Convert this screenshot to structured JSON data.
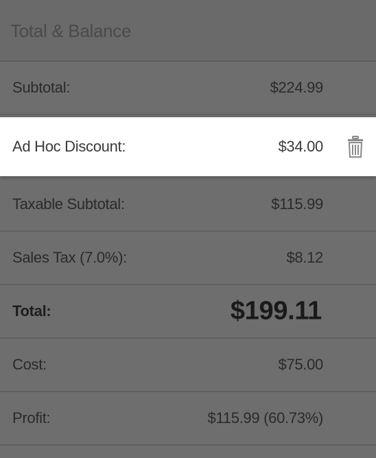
{
  "section": {
    "title": "Total & Balance"
  },
  "rows": {
    "subtotal": {
      "label": "Subtotal:",
      "value": "$224.99"
    },
    "discount": {
      "label": "Ad Hoc Discount:",
      "value": "$34.00",
      "action_icon": "trash-icon"
    },
    "taxable_subtotal": {
      "label": "Taxable Subtotal:",
      "value": "$115.99"
    },
    "sales_tax": {
      "label": "Sales Tax (7.0%):",
      "value": "$8.12"
    },
    "total": {
      "label": "Total:",
      "value": "$199.11"
    },
    "cost": {
      "label": "Cost:",
      "value": "$75.00"
    },
    "profit": {
      "label": "Profit:",
      "value": "$115.99 (60.73%)"
    }
  },
  "colors": {
    "overlay": "#6e6e6e",
    "highlight_row": "#ffffff",
    "icon": "#8a8a8a"
  }
}
